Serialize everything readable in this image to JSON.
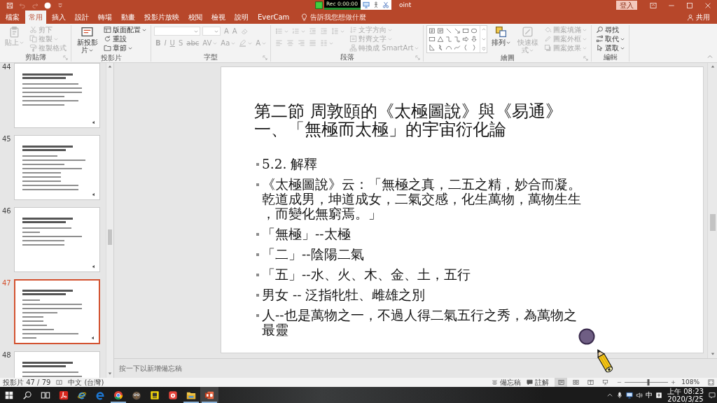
{
  "title_bar": {
    "title": "oint",
    "sign_in": "登入"
  },
  "recorder": {
    "time": "Rec 0:00:00"
  },
  "tabs": [
    {
      "label": "檔案",
      "selected": false
    },
    {
      "label": "常用",
      "selected": true
    },
    {
      "label": "插入",
      "selected": false
    },
    {
      "label": "設計",
      "selected": false
    },
    {
      "label": "轉場",
      "selected": false
    },
    {
      "label": "動畫",
      "selected": false
    },
    {
      "label": "投影片放映",
      "selected": false
    },
    {
      "label": "校閱",
      "selected": false
    },
    {
      "label": "檢視",
      "selected": false
    },
    {
      "label": "說明",
      "selected": false
    },
    {
      "label": "EverCam",
      "selected": false
    }
  ],
  "tell_me": {
    "placeholder": "告訴我您想做什麼"
  },
  "share": {
    "label": "共用"
  },
  "ribbon": {
    "groups": [
      {
        "label": "剪貼簿",
        "launcher": true,
        "columns": [
          [
            [
              {
                "kind": "large",
                "label": "貼上",
                "disabled": true,
                "dropdown": true
              }
            ]
          ],
          [
            [
              {
                "kind": "small",
                "label": "剪下",
                "disabled": true,
                "dropdown": false
              }
            ],
            [
              {
                "kind": "small",
                "label": "複製",
                "disabled": true,
                "dropdown": true
              }
            ],
            [
              {
                "kind": "small",
                "label": "複製格式",
                "disabled": true,
                "dropdown": false
              }
            ]
          ]
        ]
      },
      {
        "label": "投影片",
        "launcher": false,
        "columns": [
          [
            [
              {
                "kind": "large",
                "label": "新投影片",
                "disabled": false,
                "dropdown": true
              }
            ]
          ],
          [
            [
              {
                "kind": "small",
                "label": "版面配置",
                "disabled": false,
                "dropdown": true
              }
            ],
            [
              {
                "kind": "small",
                "label": "重設",
                "disabled": false,
                "dropdown": false
              }
            ],
            [
              {
                "kind": "small",
                "label": "章節",
                "disabled": false,
                "dropdown": true
              }
            ]
          ]
        ]
      },
      {
        "label": "字型",
        "launcher": true,
        "columns": [
          [
            [
              {
                "kind": "font_name",
                "disabled": true
              },
              {
                "kind": "font_size",
                "disabled": true
              },
              {
                "kind": "glyph",
                "label": "A",
                "disabled": true,
                "dropdown": false
              },
              {
                "kind": "glyph",
                "label": "A",
                "disabled": true,
                "dropdown": false
              },
              {
                "kind": "icon",
                "disabled": true,
                "dropdown": false
              }
            ],
            [
              {
                "kind": "glyph",
                "label": "B",
                "disabled": true,
                "dropdown": false
              },
              {
                "kind": "glyph",
                "label": "I",
                "disabled": true,
                "dropdown": false
              },
              {
                "kind": "glyph",
                "label": "U",
                "disabled": true,
                "dropdown": false
              },
              {
                "kind": "glyph",
                "label": "S",
                "disabled": true,
                "dropdown": false
              },
              {
                "kind": "glyph",
                "label": "abc",
                "disabled": true,
                "dropdown": false
              },
              {
                "kind": "glyph",
                "label": "AV",
                "disabled": true,
                "dropdown": true
              },
              {
                "kind": "glyph",
                "label": "Aa",
                "disabled": true,
                "dropdown": true
              },
              {
                "kind": "icon",
                "disabled": true,
                "dropdown": true
              },
              {
                "kind": "glyph",
                "label": "A",
                "disabled": true,
                "dropdown": true
              }
            ]
          ]
        ]
      },
      {
        "label": "段落",
        "launcher": true,
        "columns": [
          [
            [
              {
                "kind": "icon",
                "disabled": true,
                "dropdown": true
              },
              {
                "kind": "icon",
                "disabled": true,
                "dropdown": true
              },
              {
                "kind": "icon",
                "disabled": true,
                "dropdown": false
              },
              {
                "kind": "icon",
                "disabled": true,
                "dropdown": false
              },
              {
                "kind": "icon",
                "disabled": true,
                "dropdown": true
              }
            ],
            [
              {
                "kind": "icon",
                "disabled": true,
                "dropdown": false
              },
              {
                "kind": "icon",
                "disabled": true,
                "dropdown": false
              },
              {
                "kind": "icon",
                "disabled": true,
                "dropdown": false
              },
              {
                "kind": "icon",
                "disabled": true,
                "dropdown": false
              },
              {
                "kind": "icon",
                "disabled": true,
                "dropdown": true
              }
            ]
          ],
          [
            [
              {
                "kind": "small",
                "label": "文字方向",
                "disabled": true,
                "dropdown": true
              }
            ],
            [
              {
                "kind": "small",
                "label": "對齊文字",
                "disabled": true,
                "dropdown": true
              }
            ],
            [
              {
                "kind": "small",
                "label": "轉換成 SmartArt",
                "disabled": true,
                "dropdown": true
              }
            ]
          ]
        ]
      },
      {
        "label": "繪圖",
        "launcher": true,
        "columns": [
          [
            [
              {
                "kind": "gallery",
                "disabled": false
              }
            ]
          ],
          [
            [
              {
                "kind": "large",
                "label": "排列",
                "disabled": false,
                "dropdown": true
              }
            ]
          ],
          [
            [
              {
                "kind": "large",
                "label": "快速樣式",
                "disabled": true,
                "dropdown": true
              }
            ]
          ],
          [
            [
              {
                "kind": "small",
                "label": "圖案填滿",
                "disabled": true,
                "dropdown": true
              }
            ],
            [
              {
                "kind": "small",
                "label": "圖案外框",
                "disabled": true,
                "dropdown": true
              }
            ],
            [
              {
                "kind": "small",
                "label": "圖案效果",
                "disabled": true,
                "dropdown": true
              }
            ]
          ]
        ]
      },
      {
        "label": "編輯",
        "launcher": false,
        "columns": [
          [
            [
              {
                "kind": "small",
                "label": "尋找",
                "disabled": false,
                "dropdown": false
              }
            ],
            [
              {
                "kind": "small",
                "label": "取代",
                "disabled": false,
                "dropdown": true
              }
            ],
            [
              {
                "kind": "small",
                "label": "選取",
                "disabled": false,
                "dropdown": true
              }
            ]
          ]
        ]
      }
    ]
  },
  "slides_pane": {
    "thumbnails": [
      {
        "number": "44",
        "selected": false
      },
      {
        "number": "45",
        "selected": false
      },
      {
        "number": "46",
        "selected": false
      },
      {
        "number": "47",
        "selected": true
      },
      {
        "number": "48",
        "selected": false
      }
    ]
  },
  "slide": {
    "title_lines": [
      "第二節 周敦頤的《太極圖說》與《易通》",
      "一、「無極而太極」的宇宙衍化論"
    ],
    "bullets": [
      {
        "lines": [
          "5.2. 解釋"
        ]
      },
      {
        "lines": [
          "《太極圖說》云：「無極之真，二五之精，妙合而凝。",
          "乾道成男，坤道成女，二氣交感，化生萬物，萬物生生",
          "，而變化無窮焉。」"
        ]
      },
      {
        "lines": [
          "「無極」--太極"
        ]
      },
      {
        "lines": [
          "「二」--陰陽二氣"
        ]
      },
      {
        "lines": [
          "「五」--水、火、木、金、土，五行"
        ]
      },
      {
        "lines": [
          "男女 -- 泛指牝牡、雌雄之別"
        ]
      },
      {
        "lines": [
          "人--也是萬物之一，不過人得二氣五行之秀，為萬物之",
          "最靈"
        ]
      }
    ]
  },
  "notes": {
    "placeholder": "按一下以新增備忘稿"
  },
  "status_bar": {
    "slide_counter": "投影片 47 / 79",
    "language": "中文 (台灣)",
    "notes": "備忘稿",
    "comments": "註解",
    "views": [
      {
        "selected": true
      },
      {
        "selected": false
      },
      {
        "selected": false
      },
      {
        "selected": false
      }
    ],
    "zoom": {
      "level": 0.54,
      "reading": "108%"
    }
  },
  "taskbar": {
    "apps": [
      {
        "running": false,
        "selected": false
      },
      {
        "running": false,
        "selected": false
      },
      {
        "running": false,
        "selected": false
      },
      {
        "running": true,
        "selected": false
      },
      {
        "running": false,
        "selected": false
      },
      {
        "running": false,
        "selected": false
      },
      {
        "running": false,
        "selected": false
      },
      {
        "running": true,
        "selected": false
      },
      {
        "running": true,
        "selected": true
      }
    ],
    "ime": "中",
    "time": "上午 08:23",
    "date": "2020/3/25"
  }
}
